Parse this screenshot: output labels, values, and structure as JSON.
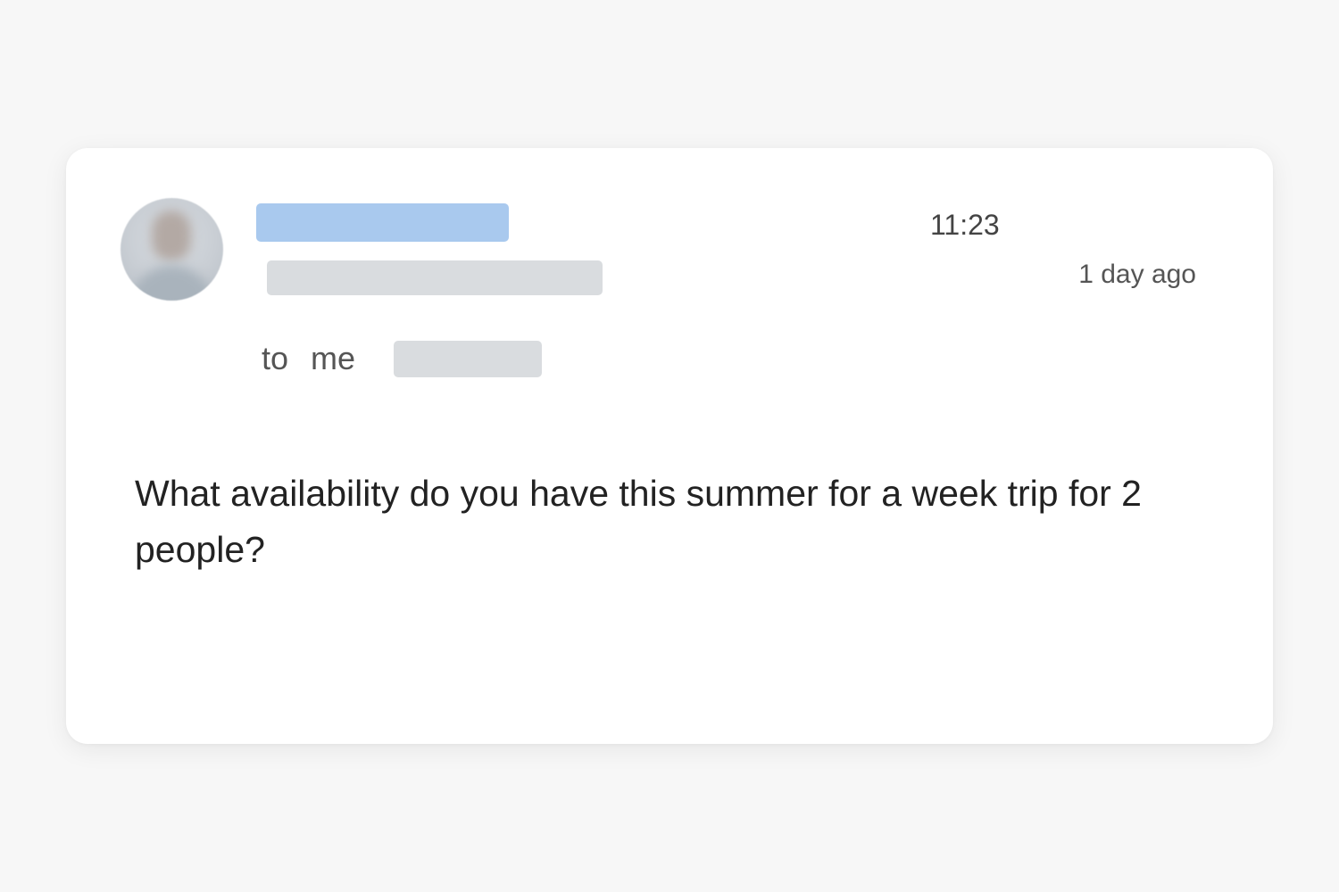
{
  "email": {
    "time": "11:23",
    "relative_time": "1 day ago",
    "to_label": "to",
    "recipient": "me",
    "body": "What availability do you have this summer for a week trip for 2 people?"
  },
  "colors": {
    "name_redaction": "#a9c9ee",
    "field_redaction": "#d9dcdf",
    "text": "#222222",
    "card": "#ffffff",
    "background": "#f7f7f7"
  }
}
